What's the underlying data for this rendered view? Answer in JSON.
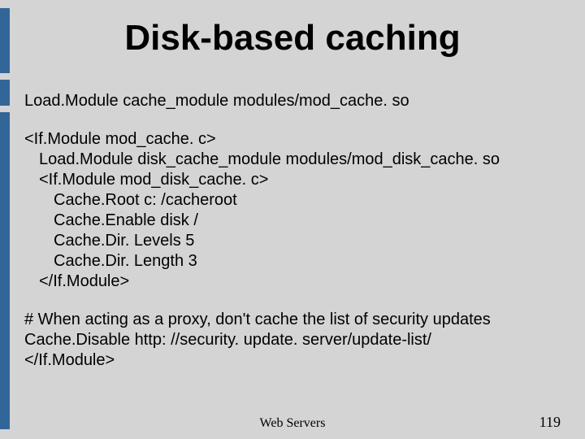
{
  "title": "Disk-based caching",
  "lines": {
    "load_module": "Load.Module cache_module modules/mod_cache. so",
    "if_open": "<If.Module mod_cache. c>",
    "disk_load": "Load.Module disk_cache_module modules/mod_disk_cache. so",
    "if_disk_open": "<If.Module mod_disk_cache. c>",
    "cache_root": "Cache.Root c: /cacheroot",
    "cache_enable": "Cache.Enable disk /",
    "cache_dir_levels": "Cache.Dir. Levels 5",
    "cache_dir_length": "Cache.Dir. Length 3",
    "if_disk_close": "</If.Module>",
    "comment": "# When acting as a proxy, don't cache the list of security updates",
    "cache_disable": "Cache.Disable http: //security. update. server/update-list/",
    "if_close": "</If.Module>"
  },
  "footer_label": "Web Servers",
  "page_number": "119"
}
